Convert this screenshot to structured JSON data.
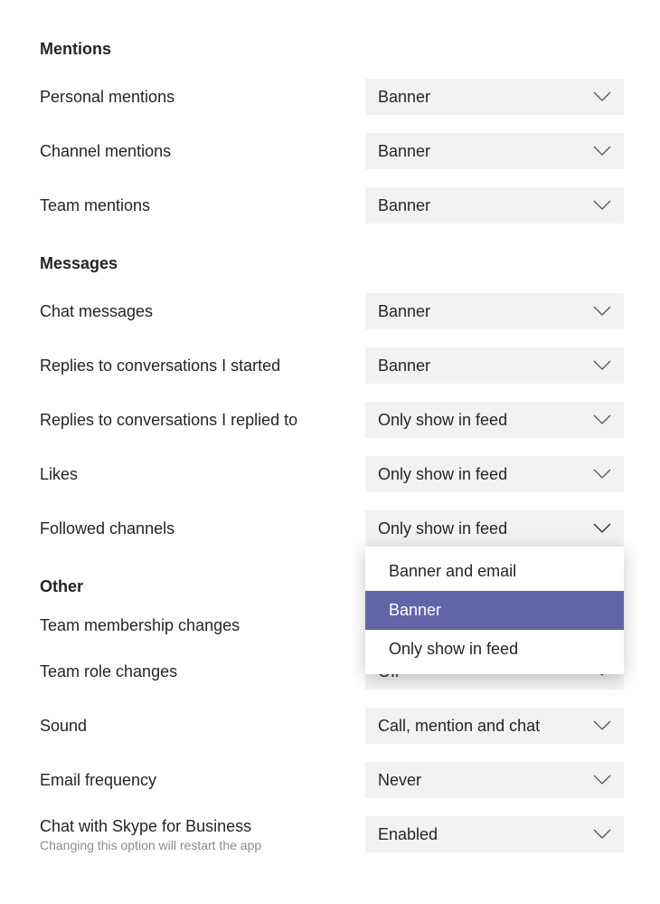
{
  "sections": {
    "mentions": {
      "title": "Mentions",
      "personal": {
        "label": "Personal mentions",
        "value": "Banner"
      },
      "channel": {
        "label": "Channel mentions",
        "value": "Banner"
      },
      "team": {
        "label": "Team mentions",
        "value": "Banner"
      }
    },
    "messages": {
      "title": "Messages",
      "chat": {
        "label": "Chat messages",
        "value": "Banner"
      },
      "replies_started": {
        "label": "Replies to conversations I started",
        "value": "Banner"
      },
      "replies_replied": {
        "label": "Replies to conversations I replied to",
        "value": "Only show in feed"
      },
      "likes": {
        "label": "Likes",
        "value": "Only show in feed"
      },
      "followed": {
        "label": "Followed channels",
        "value": "Only show in feed",
        "options": [
          "Banner and email",
          "Banner",
          "Only show in feed"
        ],
        "highlighted": "Banner"
      }
    },
    "other": {
      "title": "Other",
      "membership": {
        "label": "Team membership changes",
        "value": ""
      },
      "role": {
        "label": "Team role changes",
        "value": "Off"
      },
      "sound": {
        "label": "Sound",
        "value": "Call, mention and chat"
      },
      "email": {
        "label": "Email frequency",
        "value": "Never"
      },
      "skype": {
        "label": "Chat with Skype for Business",
        "value": "Enabled",
        "sub": "Changing this option will restart the app"
      }
    }
  }
}
